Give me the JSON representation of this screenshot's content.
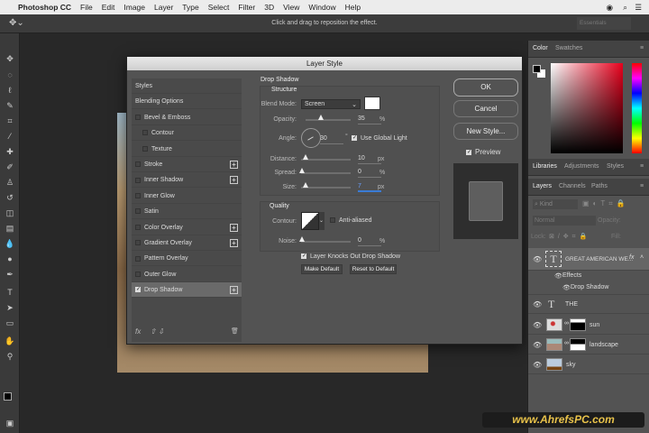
{
  "menubar": {
    "apple": "",
    "app": "Photoshop CC",
    "items": [
      "File",
      "Edit",
      "Image",
      "Layer",
      "Type",
      "Select",
      "Filter",
      "3D",
      "View",
      "Window",
      "Help"
    ]
  },
  "optionsbar": {
    "hint": "Click and drag to reposition the effect.",
    "workspace": "Essentials"
  },
  "dialog": {
    "title": "Layer Style",
    "styles": [
      {
        "label": "Styles",
        "checkbox": false,
        "plus": false
      },
      {
        "label": "Blending Options",
        "checkbox": false,
        "plus": false
      },
      {
        "label": "Bevel & Emboss",
        "checkbox": true,
        "checked": false,
        "plus": false
      },
      {
        "label": "Contour",
        "checkbox": true,
        "checked": false,
        "plus": false,
        "indent": true
      },
      {
        "label": "Texture",
        "checkbox": true,
        "checked": false,
        "plus": false,
        "indent": true
      },
      {
        "label": "Stroke",
        "checkbox": true,
        "checked": false,
        "plus": true
      },
      {
        "label": "Inner Shadow",
        "checkbox": true,
        "checked": false,
        "plus": true
      },
      {
        "label": "Inner Glow",
        "checkbox": true,
        "checked": false,
        "plus": false
      },
      {
        "label": "Satin",
        "checkbox": true,
        "checked": false,
        "plus": false
      },
      {
        "label": "Color Overlay",
        "checkbox": true,
        "checked": false,
        "plus": true
      },
      {
        "label": "Gradient Overlay",
        "checkbox": true,
        "checked": false,
        "plus": true
      },
      {
        "label": "Pattern Overlay",
        "checkbox": true,
        "checked": false,
        "plus": false
      },
      {
        "label": "Outer Glow",
        "checkbox": true,
        "checked": false,
        "plus": false
      },
      {
        "label": "Drop Shadow",
        "checkbox": true,
        "checked": true,
        "plus": true,
        "selected": true
      }
    ],
    "fx_label": "fx",
    "section_title": "Drop Shadow",
    "structure": {
      "title": "Structure",
      "blend_mode_label": "Blend Mode:",
      "blend_mode": "Screen",
      "shadow_color": "#ffffff",
      "opacity_label": "Opacity:",
      "opacity": "35",
      "opacity_unit": "%",
      "angle_label": "Angle:",
      "angle": "30",
      "angle_unit": "°",
      "use_global_light": "Use Global Light",
      "distance_label": "Distance:",
      "distance": "10",
      "distance_unit": "px",
      "spread_label": "Spread:",
      "spread": "0",
      "spread_unit": "%",
      "size_label": "Size:",
      "size": "7",
      "size_unit": "px"
    },
    "quality": {
      "title": "Quality",
      "contour_label": "Contour:",
      "anti_aliased": "Anti-aliased",
      "noise_label": "Noise:",
      "noise": "0",
      "noise_unit": "%"
    },
    "layer_knocks_out": "Layer Knocks Out Drop Shadow",
    "make_default": "Make Default",
    "reset_default": "Reset to Default",
    "ok": "OK",
    "cancel": "Cancel",
    "new_style": "New Style...",
    "preview": "Preview"
  },
  "panels": {
    "color_tabs": [
      "Color",
      "Swatches"
    ],
    "lib_tabs": [
      "Libraries",
      "Adjustments",
      "Styles"
    ],
    "layer_tabs": [
      "Layers",
      "Channels",
      "Paths"
    ],
    "kind": "Kind",
    "blend": "Normal",
    "opacity_label": "Opacity:",
    "lock_label": "Lock:",
    "fill_label": "Fill:",
    "layers": [
      {
        "name": "GREAT AMERICAN WE...",
        "type": "text",
        "fx": "fx",
        "selected": true
      },
      {
        "name": "Effects",
        "type": "effects"
      },
      {
        "name": "Drop Shadow",
        "type": "effect"
      },
      {
        "name": "THE",
        "type": "text"
      },
      {
        "name": "sun",
        "type": "image"
      },
      {
        "name": "landscape",
        "type": "image"
      },
      {
        "name": "sky",
        "type": "image"
      }
    ]
  },
  "watermark": "www.AhrefsPC.com"
}
